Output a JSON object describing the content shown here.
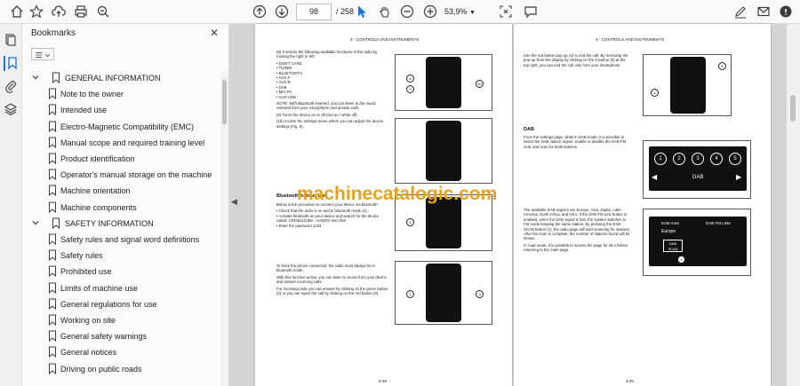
{
  "toolbar": {
    "page_current": "98",
    "page_total": "/ 258",
    "zoom": "53,9%"
  },
  "bookmarks": {
    "title": "Bookmarks",
    "items": [
      {
        "label": "GENERAL INFORMATION",
        "level": 0
      },
      {
        "label": "Note to the owner",
        "level": 1
      },
      {
        "label": "Intended use",
        "level": 1
      },
      {
        "label": "Electro-Magnetic Compatibility (EMC)",
        "level": 1
      },
      {
        "label": "Manual scope and required training level",
        "level": 1
      },
      {
        "label": "Product identification",
        "level": 1
      },
      {
        "label": "Operator's manual storage on the machine",
        "level": 1
      },
      {
        "label": "Machine orientation",
        "level": 1
      },
      {
        "label": "Machine components",
        "level": 1
      },
      {
        "label": "SAFETY INFORMATION",
        "level": 0
      },
      {
        "label": "Safety rules and signal word definitions",
        "level": 1
      },
      {
        "label": "Safety rules",
        "level": 1
      },
      {
        "label": "Prohibited use",
        "level": 1
      },
      {
        "label": "Limits of machine use",
        "level": 1
      },
      {
        "label": "General regulations for use",
        "level": 1
      },
      {
        "label": "Working on site",
        "level": 1
      },
      {
        "label": "General safety warnings",
        "level": 1
      },
      {
        "label": "General notices",
        "level": 1
      },
      {
        "label": "Driving on public roads",
        "level": 1
      }
    ]
  },
  "left_page": {
    "header": "3 - CONTROLS AND INSTRUMENTS",
    "intro": "(8) It selects the following available functions of the radio by moving the right or left:",
    "list": [
      "DON'T CARE",
      "TUNER",
      "BLUETOOTH",
      "AUX-F",
      "AUX-R",
      "DAB",
      "MIC-PA",
      "AUX-ADD"
    ],
    "note": "NOTE: With Bluetooth inserted, you can listen to the music selected from your smartphone and answer calls.",
    "item9": "(9) Turns the device on or off (red on / white off).",
    "item10": "(10) Access the settings menu where you can adjust the device settings (Fig. 8).",
    "bt_heading": "Bluetooth connection",
    "bt_intro": "Below is the procedure to connect your device via bluetooth:",
    "bt_steps": [
      "Check that the radio is on and in bluetooth mode (1).",
      "Activate bluetooth on your device and search for the device called: CRD461ZUBA - HANDS and click",
      "Enter the password 1234"
    ],
    "para1": "To have the phone connected, the radio must always be in bluetooth mode.",
    "para2": "With this function active, you can listen to music from your device and answer incoming calls.",
    "para3": "For incoming calls you can answer by clicking on the green button (2) or you can reject the call by clicking on the red button (3).",
    "page_number": "3-39"
  },
  "right_page": {
    "header": "3 - CONTROLS AND INSTRUMENTS",
    "para1": "Use the red button pop up (4) to end the call. By removing the pop-up from the display by clicking on the X button (5) at the top right, you can end the call only from your smartphone.",
    "dab_heading": "DAB",
    "dab_para": "From the settings page, while in DAB mode, it is possible to select the DAB station region, enable or disable the DAB FM Link, and scan for DAB stations.",
    "dab_buttons": [
      "1",
      "2",
      "3",
      "4",
      "5"
    ],
    "dab_label": "DAB",
    "regions_para": "The available DAB regions are Europe, Asia, Japan, Latin America, North Africa, and USA. If the DAB FM Link button is enabled, when the DAB signal is lost, the system switches to FM mode keeping the same station. By pressing the DAB SCAN button (1), the radio page will start scanning for stations. After the scan is complete, the number of stations found will be shown.",
    "road_para": "In road mode, it is possible to access the page for 45 s before returning to the main page.",
    "dab_area_label": "DAB Area",
    "dab_area_value": "Europe",
    "dab_fm_link": "DAB FM LINK",
    "dab_scan": "DAB SCAN",
    "page_number": "3-40"
  },
  "watermark": "machinecatalogic.com"
}
